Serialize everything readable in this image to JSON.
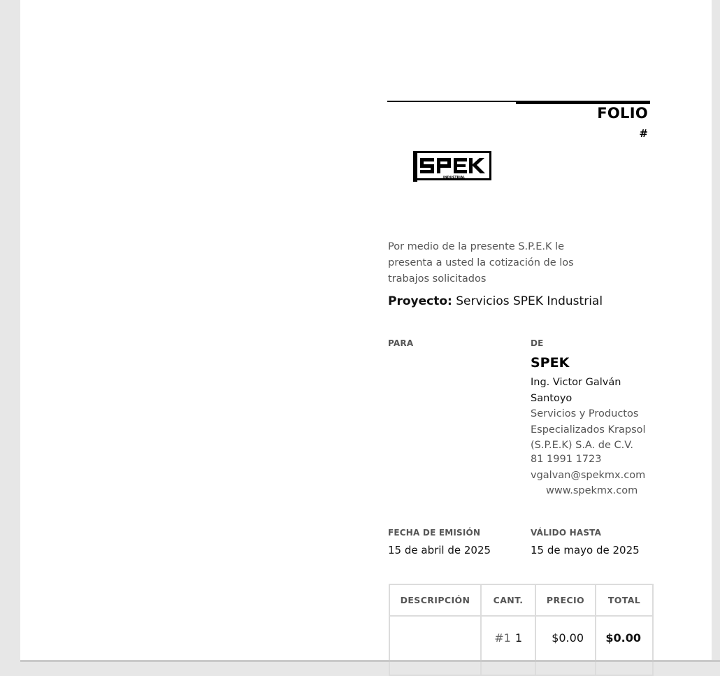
{
  "header": {
    "folio_title": "FOLIO",
    "folio_number": "#"
  },
  "logo": {
    "text": "SPEK",
    "subtext": "INDUSTRIAL"
  },
  "intro_text": "Por medio de la presente S.P.E.K le presenta a usted la cotización de los trabajos solicitados",
  "project": {
    "label": "Proyecto:",
    "value": "Servicios SPEK Industrial"
  },
  "to": {
    "label": "PARA"
  },
  "from": {
    "label": "DE",
    "name": "SPEK",
    "contact": "Ing. Victor Galván Santoyo",
    "company": "Servicios y Productos Especializados Krapsol (S.P.E.K) S.A. de C.V.",
    "phone": "81 1991 1723",
    "email": "vgalvan@spekmx.com",
    "website": "www.spekmx.com"
  },
  "dates": {
    "issue_label": "FECHA DE EMISIÓN",
    "issue_value": "15 de abril de 2025",
    "valid_label": "VÁLIDO HASTA",
    "valid_value": "15 de mayo de 2025"
  },
  "table": {
    "headers": {
      "description": "DESCRIPCIÓN",
      "quantity": "CANT.",
      "price": "PRECIO",
      "total": "TOTAL"
    },
    "rows": [
      {
        "description": "",
        "index": "#1",
        "quantity": "1",
        "price": "$0.00",
        "total": "$0.00"
      }
    ]
  }
}
